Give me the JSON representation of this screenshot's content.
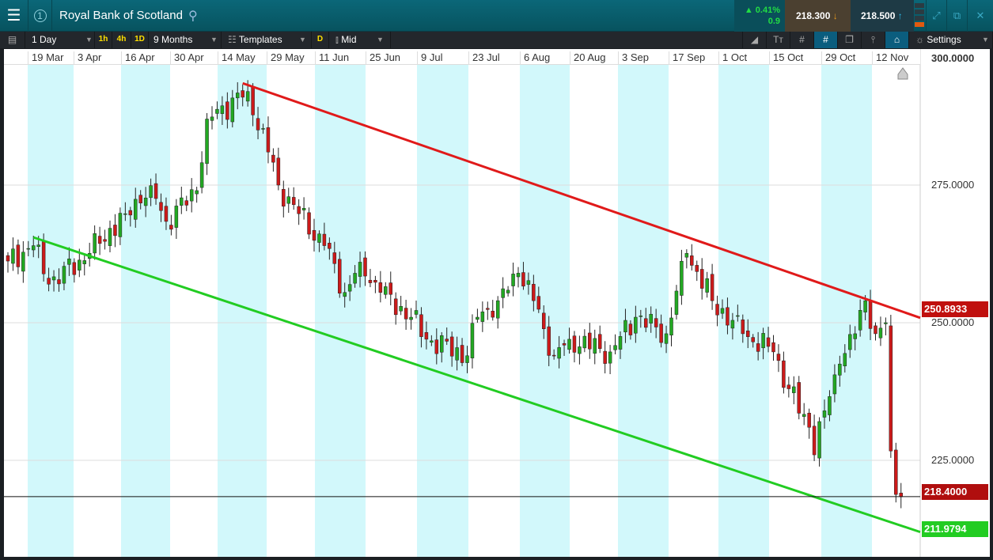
{
  "header": {
    "title": "Royal Bank of Scotland",
    "badge": "1",
    "change_pct": "▲ 0.41%",
    "change_abs": "0.9",
    "sell_price": "218.300",
    "buy_price": "218.500",
    "sell_arrow": "↓",
    "buy_arrow": "↑",
    "icons": [
      "menu-icon",
      "search-icon",
      "expand-icon",
      "popout-icon",
      "close-icon"
    ]
  },
  "toolbar": {
    "interval": "1 Day",
    "quick": [
      "1h",
      "4h",
      "1D"
    ],
    "range": "9 Months",
    "templates": "Templates",
    "d": "D",
    "price_type": "Mid",
    "settings": "Settings"
  },
  "colors": {
    "up": "#22a822",
    "down": "#cc1a1a",
    "resistance": "#e01a1a",
    "support": "#22cc22",
    "band": "#d2f8fb",
    "price_tag": "#c0100e"
  },
  "chart_data": {
    "type": "candlestick",
    "title": "Royal Bank of Scotland",
    "x_tick_labels": [
      "19 Mar",
      "3 Apr",
      "16 Apr",
      "30 Apr",
      "14 May",
      "29 May",
      "11 Jun",
      "25 Jun",
      "9 Jul",
      "23 Jul",
      "6 Aug",
      "20 Aug",
      "3 Sep",
      "17 Sep",
      "1 Oct",
      "15 Oct",
      "29 Oct",
      "12 Nov"
    ],
    "y_tick_labels": [
      "300.0000",
      "275.0000",
      "250.0000",
      "225.0000"
    ],
    "ylim": [
      209,
      301
    ],
    "n_days": 176,
    "close_keypoints": [
      [
        0,
        261.2
      ],
      [
        5,
        264
      ],
      [
        8,
        257
      ],
      [
        16,
        262.6
      ],
      [
        23,
        269.8
      ],
      [
        28,
        274.9
      ],
      [
        31,
        268.4
      ],
      [
        37,
        274
      ],
      [
        39,
        287
      ],
      [
        47,
        292
      ],
      [
        51,
        281
      ],
      [
        53,
        275
      ],
      [
        57,
        269.8
      ],
      [
        62,
        264
      ],
      [
        66,
        255.5
      ],
      [
        69,
        261
      ],
      [
        73,
        255.5
      ],
      [
        79,
        251
      ],
      [
        82,
        247
      ],
      [
        90,
        244
      ],
      [
        92,
        251
      ],
      [
        96,
        254
      ],
      [
        100,
        259
      ],
      [
        103,
        254
      ],
      [
        107,
        244
      ],
      [
        110,
        247
      ],
      [
        118,
        244.7
      ],
      [
        123,
        251
      ],
      [
        129,
        248
      ],
      [
        133,
        262.6
      ],
      [
        138,
        254
      ],
      [
        144,
        248
      ],
      [
        150,
        244.7
      ],
      [
        153,
        238
      ],
      [
        157,
        231
      ],
      [
        158,
        226
      ],
      [
        160,
        234
      ],
      [
        163,
        242.5
      ],
      [
        166,
        248
      ],
      [
        168,
        254
      ],
      [
        170,
        248
      ],
      [
        172,
        250
      ],
      [
        173,
        226.7
      ],
      [
        174,
        218.8
      ],
      [
        175,
        218.4
      ]
    ],
    "trendlines": [
      {
        "name": "resistance",
        "from": [
          46,
          293.5
        ],
        "value_at_edge": 250.8933,
        "label": "250.8933"
      },
      {
        "name": "support",
        "from": [
          5,
          265.5
        ],
        "value_at_edge": 211.9794,
        "label": "211.9794"
      }
    ],
    "current_price": {
      "value": 218.4,
      "label": "218.4000"
    }
  }
}
